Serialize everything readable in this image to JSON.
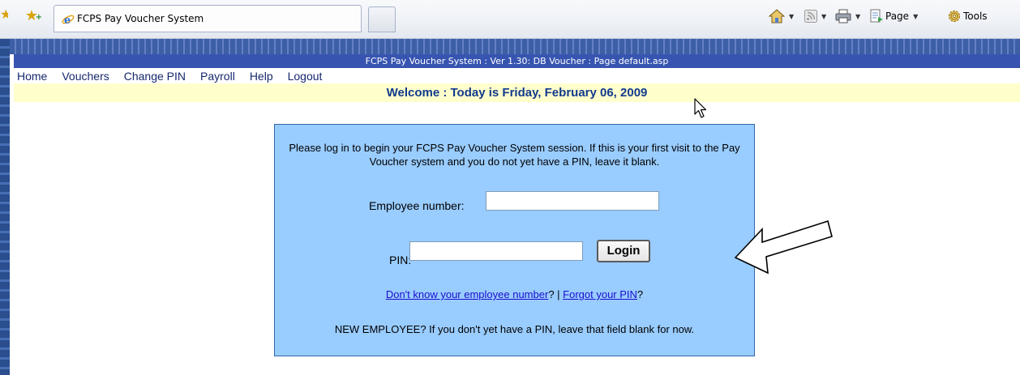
{
  "browser": {
    "tab_title": "FCPS Pay Voucher System",
    "toolbar": {
      "page_label": "Page",
      "tools_label": "Tools"
    }
  },
  "app": {
    "title_bar": "FCPS Pay Voucher System : Ver 1.30: DB Voucher : Page default.asp",
    "nav": [
      "Home",
      "Vouchers",
      "Change PIN",
      "Payroll",
      "Help",
      "Logout"
    ],
    "welcome": "Welcome : Today is Friday, February 06, 2009"
  },
  "login": {
    "intro": "Please log in to begin your FCPS Pay Voucher System session. If this is your first visit to the Pay Voucher system and you do not yet have a PIN, leave it blank.",
    "employee_label": "Employee number:",
    "employee_value": "",
    "pin_label": "PIN:",
    "pin_value": "",
    "login_button": "Login",
    "link_employee": "Don't know your employee number",
    "link_employee_suffix": "? |",
    "link_pin": "Forgot your PIN",
    "link_pin_suffix": "?",
    "new_employee_note": "NEW EMPLOYEE? If you don't yet have a PIN, leave that field blank for now."
  },
  "colors": {
    "title_bar": "#3755b0",
    "welcome_bg": "#ffffcc",
    "login_bg": "#99ccff",
    "nav_text": "#16286e"
  }
}
